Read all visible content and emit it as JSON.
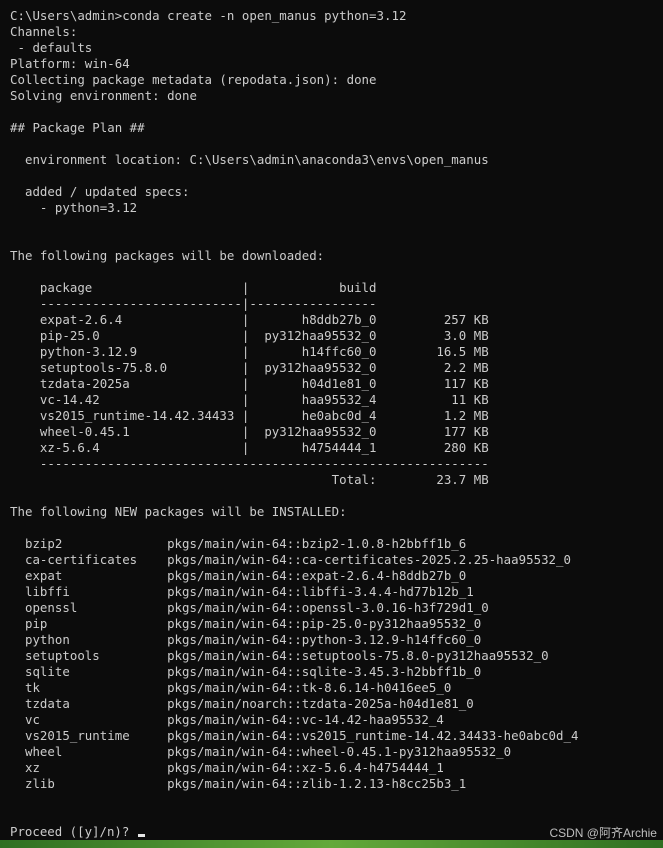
{
  "terminal": {
    "lines": [
      "C:\\Users\\admin>conda create -n open_manus python=3.12",
      "Channels:",
      " - defaults",
      "Platform: win-64",
      "Collecting package metadata (repodata.json): done",
      "Solving environment: done",
      "",
      "## Package Plan ##",
      "",
      "  environment location: C:\\Users\\admin\\anaconda3\\envs\\open_manus",
      "",
      "  added / updated specs:",
      "    - python=3.12",
      "",
      "",
      "The following packages will be downloaded:",
      "",
      "    package                    |            build",
      "    ---------------------------|-----------------",
      "    expat-2.6.4                |       h8ddb27b_0         257 KB",
      "    pip-25.0                   |  py312haa95532_0         3.0 MB",
      "    python-3.12.9              |       h14ffc60_0        16.5 MB",
      "    setuptools-75.8.0          |  py312haa95532_0         2.2 MB",
      "    tzdata-2025a               |       h04d1e81_0         117 KB",
      "    vc-14.42                   |       haa95532_4          11 KB",
      "    vs2015_runtime-14.42.34433 |       he0abc0d_4         1.2 MB",
      "    wheel-0.45.1               |  py312haa95532_0         177 KB",
      "    xz-5.6.4                   |       h4754444_1         280 KB",
      "    ------------------------------------------------------------",
      "                                           Total:        23.7 MB",
      "",
      "The following NEW packages will be INSTALLED:",
      "",
      "  bzip2              pkgs/main/win-64::bzip2-1.0.8-h2bbff1b_6",
      "  ca-certificates    pkgs/main/win-64::ca-certificates-2025.2.25-haa95532_0",
      "  expat              pkgs/main/win-64::expat-2.6.4-h8ddb27b_0",
      "  libffi             pkgs/main/win-64::libffi-3.4.4-hd77b12b_1",
      "  openssl            pkgs/main/win-64::openssl-3.0.16-h3f729d1_0",
      "  pip                pkgs/main/win-64::pip-25.0-py312haa95532_0",
      "  python             pkgs/main/win-64::python-3.12.9-h14ffc60_0",
      "  setuptools         pkgs/main/win-64::setuptools-75.8.0-py312haa95532_0",
      "  sqlite             pkgs/main/win-64::sqlite-3.45.3-h2bbff1b_0",
      "  tk                 pkgs/main/win-64::tk-8.6.14-h0416ee5_0",
      "  tzdata             pkgs/main/noarch::tzdata-2025a-h04d1e81_0",
      "  vc                 pkgs/main/win-64::vc-14.42-haa95532_4",
      "  vs2015_runtime     pkgs/main/win-64::vs2015_runtime-14.42.34433-he0abc0d_4",
      "  wheel              pkgs/main/win-64::wheel-0.45.1-py312haa95532_0",
      "  xz                 pkgs/main/win-64::xz-5.6.4-h4754444_1",
      "  zlib               pkgs/main/win-64::zlib-1.2.13-h8cc25b3_1"
    ],
    "prompt": "Proceed ([y]/n)? "
  },
  "watermark": "CSDN @阿齐Archie",
  "colors": {
    "background": "#0c0c0c",
    "text": "#cccccc",
    "desktop": "#3a7d2a"
  }
}
